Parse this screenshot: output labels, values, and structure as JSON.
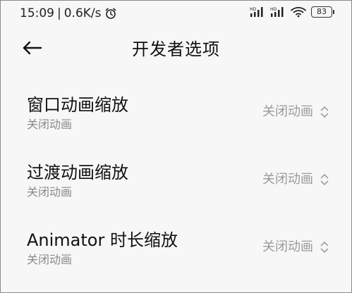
{
  "status_bar": {
    "time": "15:09",
    "separator": "|",
    "network_speed": "0.6K/s",
    "alarm_icon": "alarm-clock-icon",
    "signal_1_label": "HD",
    "signal_2_label": "HD",
    "wifi_icon": "wifi-icon",
    "battery_level": "83"
  },
  "header": {
    "back_icon": "arrow-left-icon",
    "title": "开发者选项"
  },
  "settings": [
    {
      "title": "窗口动画缩放",
      "subtitle": "关闭动画",
      "value": "关闭动画"
    },
    {
      "title": "过渡动画缩放",
      "subtitle": "关闭动画",
      "value": "关闭动画"
    },
    {
      "title": "Animator 时长缩放",
      "subtitle": "关闭动画",
      "value": "关闭动画"
    }
  ],
  "colors": {
    "background": "#f7f7f7",
    "primary_text": "#111111",
    "secondary_text": "#8a8a8a",
    "value_text": "#9a9a9a"
  }
}
